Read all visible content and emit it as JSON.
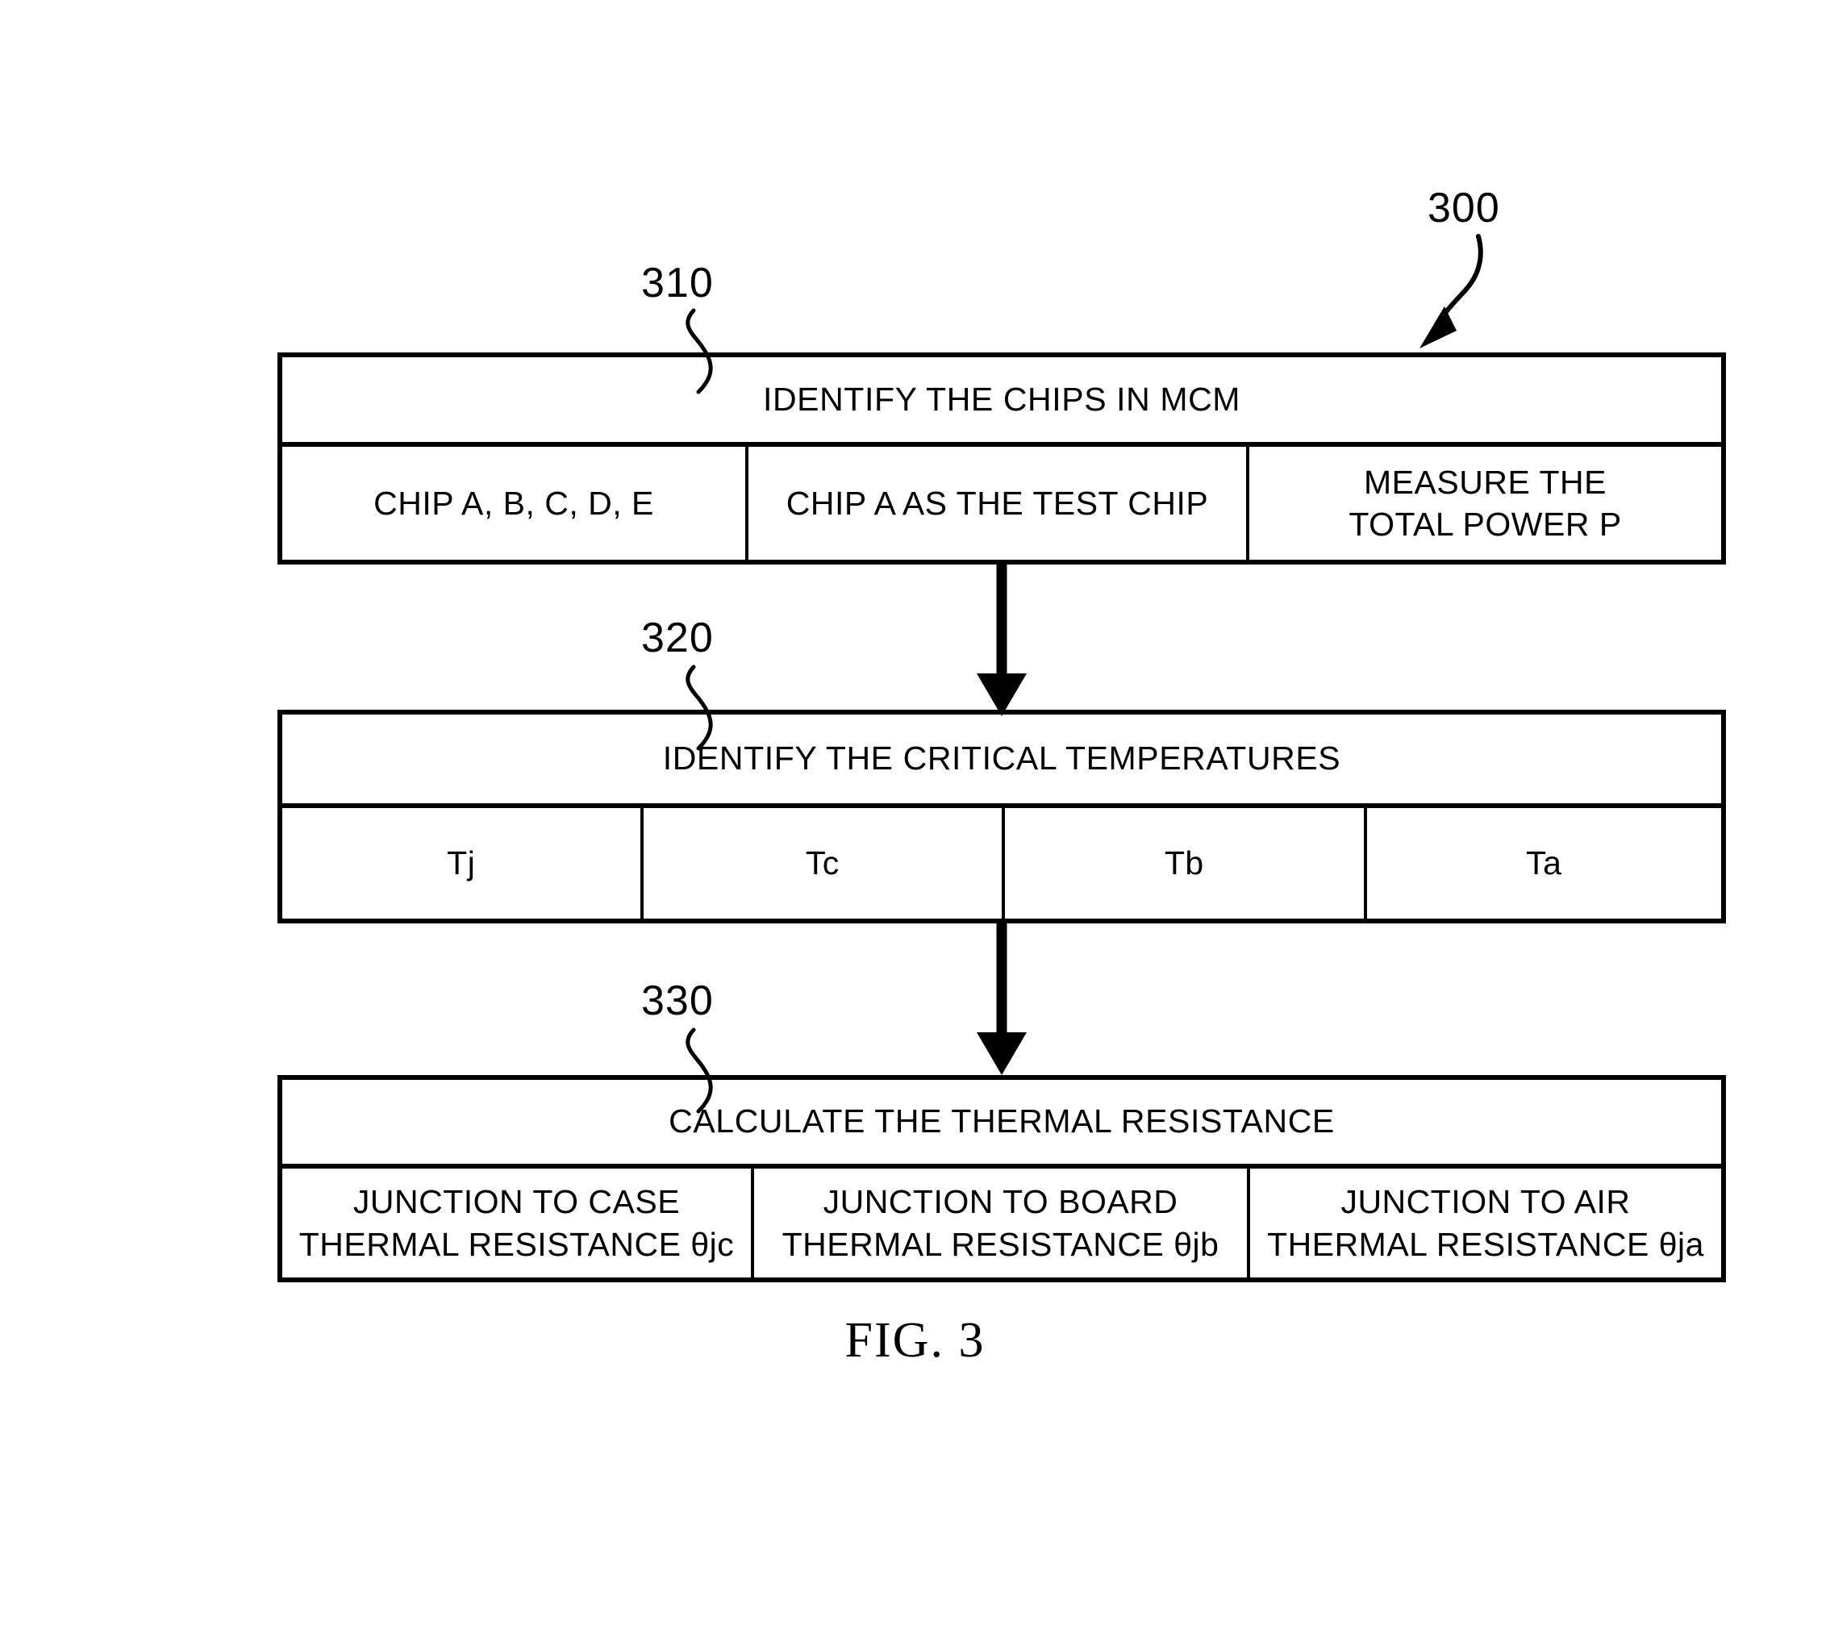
{
  "figure": {
    "caption": "FIG. 3",
    "diagram_reference": "300"
  },
  "blocks": [
    {
      "ref": "310",
      "header": "IDENTIFY THE CHIPS IN MCM",
      "cells": [
        "CHIP A, B, C, D, E",
        "CHIP A AS THE TEST CHIP",
        "MEASURE THE\nTOTAL POWER P"
      ]
    },
    {
      "ref": "320",
      "header": "IDENTIFY THE CRITICAL TEMPERATURES",
      "cells": [
        "Tj",
        "Tc",
        "Tb",
        "Ta"
      ]
    },
    {
      "ref": "330",
      "header": "CALCULATE THE THERMAL RESISTANCE",
      "cells": [
        "JUNCTION TO CASE\nTHERMAL RESISTANCE θjc",
        "JUNCTION TO BOARD\nTHERMAL RESISTANCE θjb",
        "JUNCTION TO AIR\nTHERMAL RESISTANCE θja"
      ]
    }
  ],
  "connectors": [
    {
      "name": "arrow-310-to-320",
      "from": "310",
      "to": "320"
    },
    {
      "name": "arrow-320-to-330",
      "from": "320",
      "to": "330"
    }
  ],
  "colors": {
    "ink": "#000000",
    "paper": "#ffffff"
  }
}
